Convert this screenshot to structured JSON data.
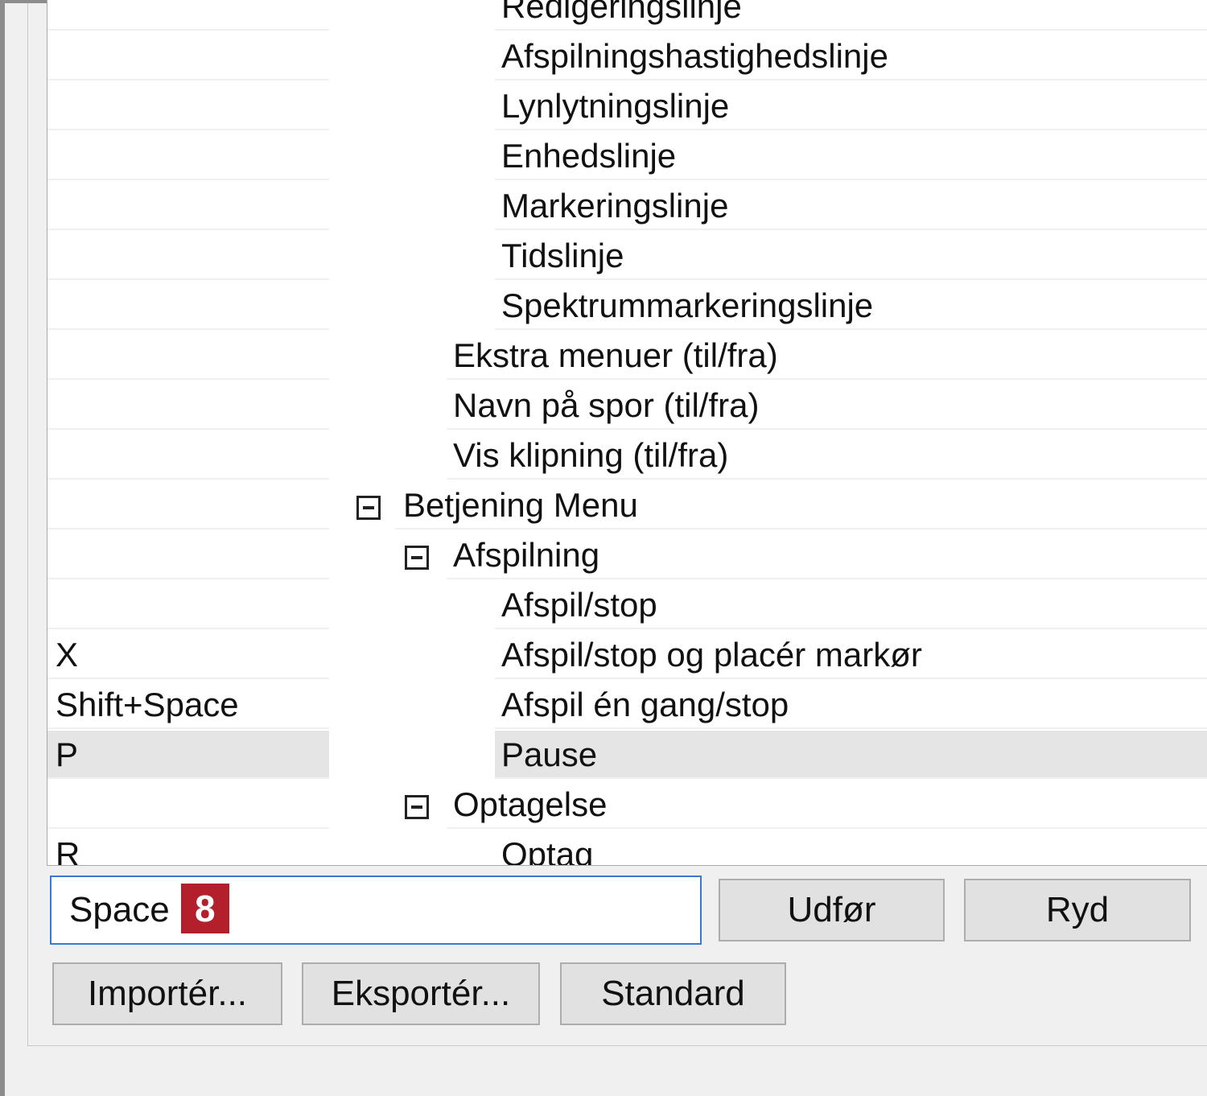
{
  "command_list": {
    "rows": [
      {
        "key": "",
        "name": "Redigeringslinje",
        "level": "leaf",
        "selected": false
      },
      {
        "key": "",
        "name": "Afspilningshastighedslinje",
        "level": "leaf",
        "selected": false
      },
      {
        "key": "",
        "name": "Lynlytningslinje",
        "level": "leaf",
        "selected": false
      },
      {
        "key": "",
        "name": "Enhedslinje",
        "level": "leaf",
        "selected": false
      },
      {
        "key": "",
        "name": "Markeringslinje",
        "level": "leaf",
        "selected": false
      },
      {
        "key": "",
        "name": "Tidslinje",
        "level": "leaf",
        "selected": false
      },
      {
        "key": "",
        "name": "Spektrummarkeringslinje",
        "level": "leaf",
        "selected": false
      },
      {
        "key": "",
        "name": "Ekstra menuer (til/fra)",
        "level": "mid",
        "selected": false
      },
      {
        "key": "",
        "name": "Navn på spor (til/fra)",
        "level": "mid",
        "selected": false
      },
      {
        "key": "",
        "name": "Vis klipning (til/fra)",
        "level": "mid",
        "selected": false
      },
      {
        "key": "",
        "name": "Betjening Menu",
        "level": "top",
        "selected": false
      },
      {
        "key": "",
        "name": "Afspilning",
        "level": "sub",
        "selected": false
      },
      {
        "key": "",
        "name": "Afspil/stop",
        "level": "leaf",
        "selected": false
      },
      {
        "key": "X",
        "name": "Afspil/stop og placér markør",
        "level": "leaf",
        "selected": false
      },
      {
        "key": "Shift+Space",
        "name": "Afspil én gang/stop",
        "level": "leaf",
        "selected": false
      },
      {
        "key": "P",
        "name": "Pause",
        "level": "leaf",
        "selected": true
      },
      {
        "key": "",
        "name": "Optagelse",
        "level": "sub",
        "selected": false
      },
      {
        "key": "R",
        "name": "Optag",
        "level": "leaf",
        "selected": false
      }
    ]
  },
  "shortcut_field": {
    "value": "Space",
    "badge": "8"
  },
  "buttons": {
    "apply": "Udfør",
    "clear": "Ryd",
    "import": "Importér...",
    "export": "Eksportér...",
    "default": "Standard"
  },
  "icons": {
    "expander": "collapse-minus-icon"
  },
  "colors": {
    "badge": "#b3202b",
    "input_border": "#3b78d0",
    "selected_row": "#e5e5e5"
  }
}
